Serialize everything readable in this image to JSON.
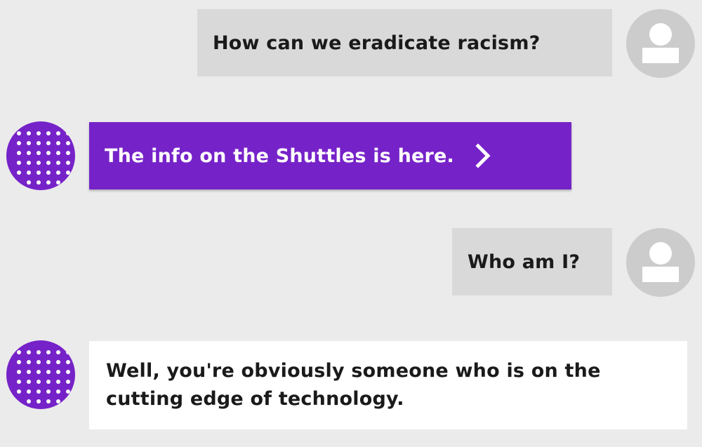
{
  "colors": {
    "background": "#ebebeb",
    "user_bubble": "#d9d9d9",
    "user_avatar": "#cccccc",
    "bot_accent": "#7622c9",
    "bot_text_bubble": "#ffffff"
  },
  "messages": [
    {
      "sender": "user",
      "text": "How can we eradicate racism?",
      "avatar_icon": "user-avatar-icon"
    },
    {
      "sender": "bot",
      "text": "The info on the Shuttles is here.",
      "action_icon": "chevron-right-icon",
      "avatar_icon": "bot-dots-avatar"
    },
    {
      "sender": "user",
      "text": "Who am I?",
      "avatar_icon": "user-avatar-icon"
    },
    {
      "sender": "bot",
      "text": "Well, you're obviously someone who is on the cutting edge of technology.",
      "avatar_icon": "bot-dots-avatar"
    }
  ]
}
